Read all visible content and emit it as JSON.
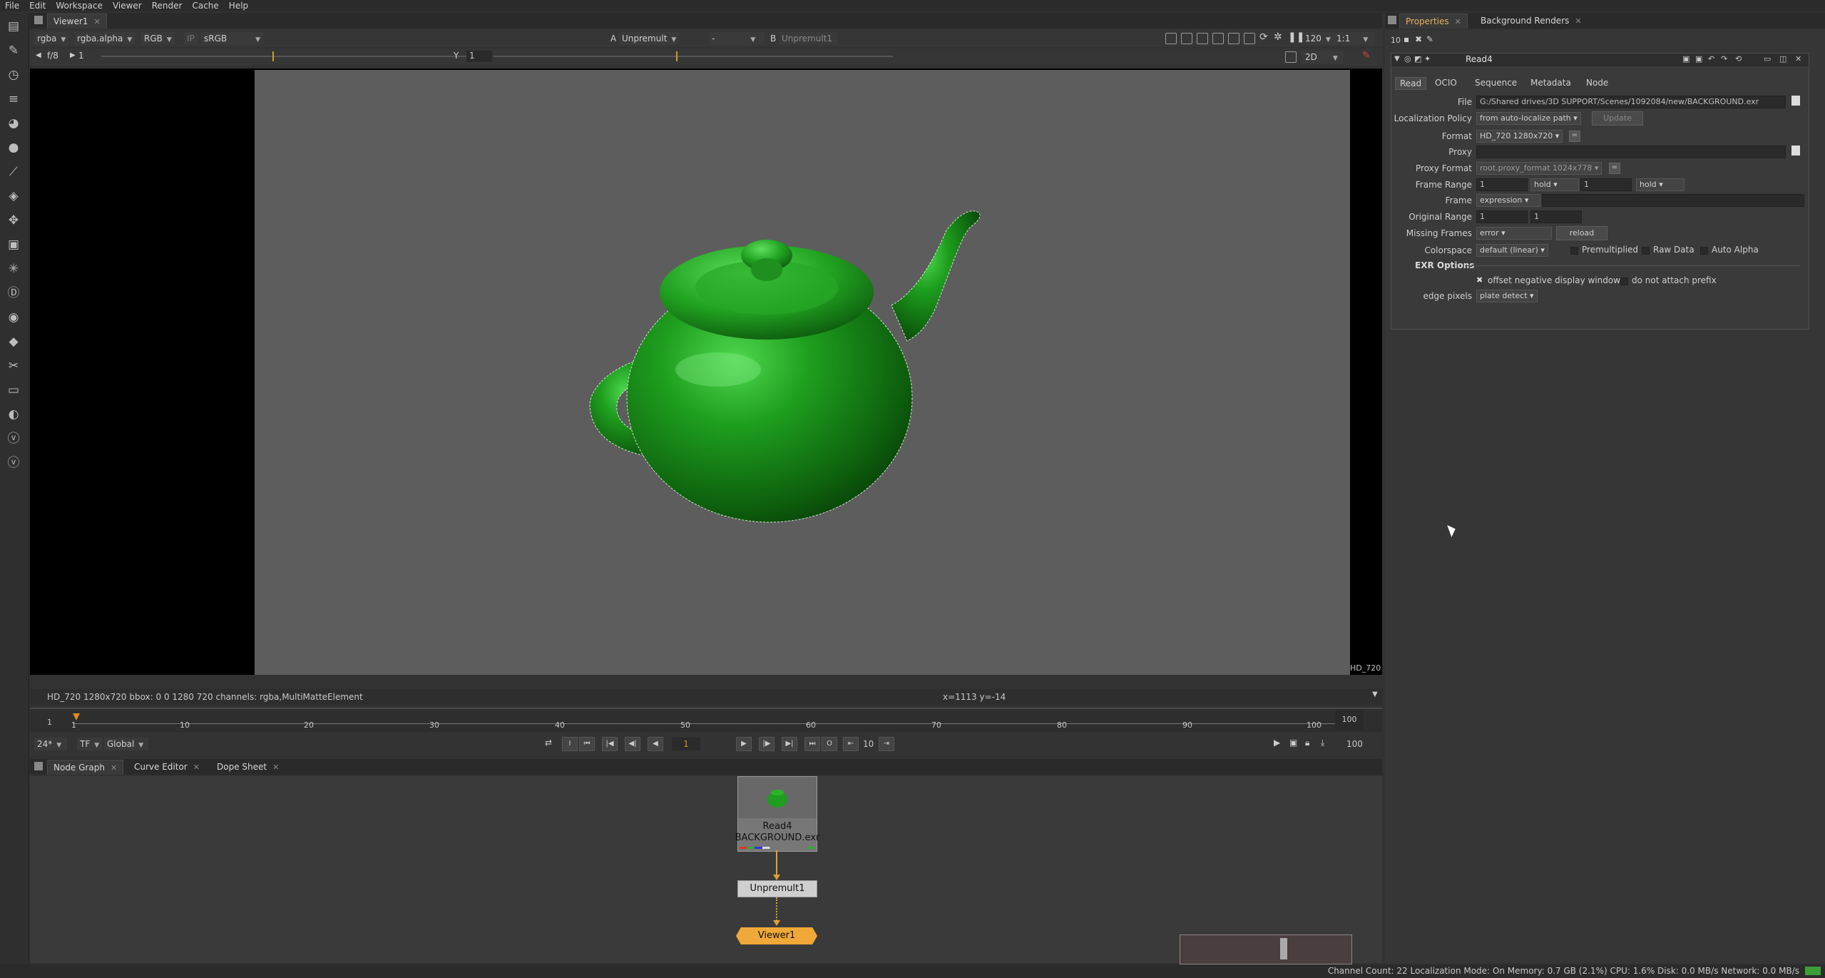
{
  "menubar": [
    "File",
    "Edit",
    "Workspace",
    "Viewer",
    "Render",
    "Cache",
    "Help"
  ],
  "viewer": {
    "tab": "Viewer1",
    "channels": "rgba",
    "alpha": "rgba.alpha",
    "display": "RGB",
    "lut": "sRGB",
    "a_label": "A",
    "a_input": "Unpremult",
    "a_op": "-",
    "b_label": "B",
    "b_input": "Unpremult1",
    "zoom": "120",
    "proxy": "1:1",
    "fstop": "f/8",
    "gain": "1",
    "gamma_label": "Y",
    "gamma": "1",
    "view_mode": "2D",
    "format_label": "HD_720",
    "info_left": "HD_720 1280x720  bbox: 0 0 1280 720 channels: rgba,MultiMatteElement",
    "info_coords": "x=1113 y=-14"
  },
  "timeline": {
    "start": "1",
    "end": "100",
    "ticks": [
      "1",
      "10",
      "20",
      "30",
      "40",
      "50",
      "60",
      "70",
      "80",
      "90",
      "100"
    ],
    "fps": "24*",
    "tf": "TF",
    "range_mode": "Global",
    "current_frame": "1",
    "increment": "10",
    "end_field": "100"
  },
  "nodegraph": {
    "tabs": [
      "Node Graph",
      "Curve Editor",
      "Dope Sheet"
    ],
    "read_node_name": "Read4",
    "read_node_file": "BACKGROUND.exr",
    "unpremult_name": "Unpremult1",
    "viewer_name": "Viewer1"
  },
  "status": "Channel Count: 22 Localization Mode: On Memory: 0.7 GB (2.1%) CPU: 1.6% Disk: 0.0 MB/s Network: 0.0 MB/s",
  "properties": {
    "tabs": [
      "Properties",
      "Background Renders"
    ],
    "max_panels": "10",
    "node_name": "Read4",
    "subtabs": [
      "Read",
      "OCIO",
      "Sequence",
      "Metadata",
      "Node"
    ],
    "file_label": "File",
    "file_value": "G:/Shared drives/3D SUPPORT/Scenes/1092084/new/BACKGROUND.exr",
    "localization_label": "Localization Policy",
    "localization_value": "from auto-localize path",
    "update_button": "Update",
    "format_label": "Format",
    "format_value": "HD_720 1280x720",
    "proxy_label": "Proxy",
    "proxy_format_label": "Proxy Format",
    "proxy_format_value": "root.proxy_format 1024x778",
    "frame_range_label": "Frame Range",
    "frame_range_start": "1",
    "frame_range_before": "hold",
    "frame_range_end": "1",
    "frame_range_after": "hold",
    "frame_label": "Frame",
    "frame_mode": "expression",
    "original_range_label": "Original Range",
    "original_start": "1",
    "original_end": "1",
    "missing_frames_label": "Missing Frames",
    "missing_frames_value": "error",
    "reload_button": "reload",
    "colorspace_label": "Colorspace",
    "colorspace_value": "default (linear)",
    "premultiplied_label": "Premultiplied",
    "raw_data_label": "Raw Data",
    "auto_alpha_label": "Auto Alpha",
    "exr_options_label": "EXR Options",
    "offset_negative_label": "offset negative display window",
    "no_prefix_label": "do not attach prefix",
    "edge_pixels_label": "edge pixels",
    "edge_pixels_value": "plate detect"
  }
}
